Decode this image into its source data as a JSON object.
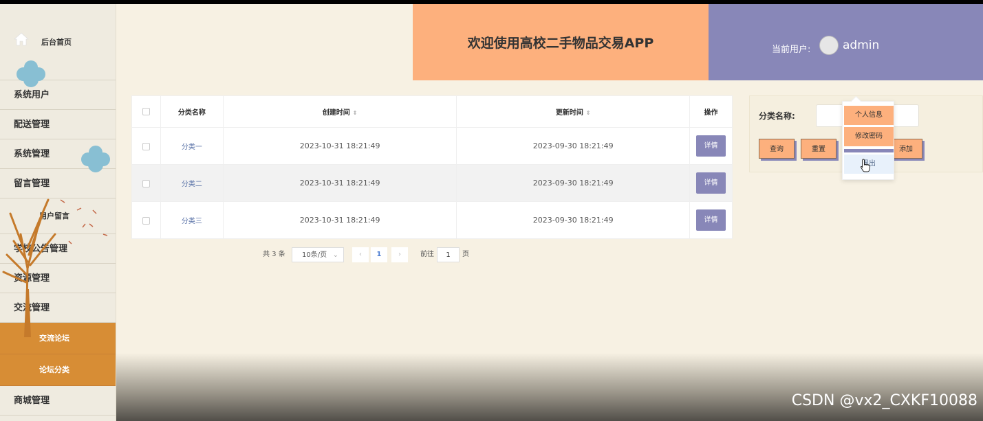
{
  "sidebar": {
    "home_label": "后台首页",
    "items": [
      {
        "label": "系统用户"
      },
      {
        "label": "配送管理"
      },
      {
        "label": "系统管理"
      },
      {
        "label": "留言管理"
      },
      {
        "label": "用户留言"
      },
      {
        "label": "学校公告管理"
      },
      {
        "label": "资源管理"
      },
      {
        "label": "交流管理"
      },
      {
        "label": "交流论坛"
      },
      {
        "label": "论坛分类"
      },
      {
        "label": "商城管理"
      }
    ]
  },
  "header": {
    "title": "欢迎使用高校二手物品交易APP",
    "user_label": "当前用户:",
    "user_name": "admin"
  },
  "table": {
    "columns": [
      "分类名称",
      "创建时间",
      "更新时间",
      "操作"
    ],
    "rows": [
      {
        "name": "分类一",
        "created": "2023-10-31 18:21:49",
        "updated": "2023-09-30 18:21:49",
        "action": "详情"
      },
      {
        "name": "分类二",
        "created": "2023-10-31 18:21:49",
        "updated": "2023-09-30 18:21:49",
        "action": "详情"
      },
      {
        "name": "分类三",
        "created": "2023-10-31 18:21:49",
        "updated": "2023-09-30 18:21:49",
        "action": "详情"
      }
    ]
  },
  "pagination": {
    "total": "共 3 条",
    "page_size": "10条/页",
    "current_page": "1",
    "goto_label": "前往",
    "goto_value": "1",
    "page_suffix": "页"
  },
  "search": {
    "label": "分类名称:",
    "query": "查询",
    "reset": "重置",
    "add": "添加"
  },
  "dropdown": {
    "profile": "个人信息",
    "password": "修改密码",
    "logout": "退出"
  },
  "watermark": "CSDN @vx2_CXKF10088",
  "colors": {
    "accent_orange": "#fdb07d",
    "accent_purple": "#8887b8",
    "background": "#f7f1e3",
    "sidebar_highlight": "#d78d35"
  }
}
